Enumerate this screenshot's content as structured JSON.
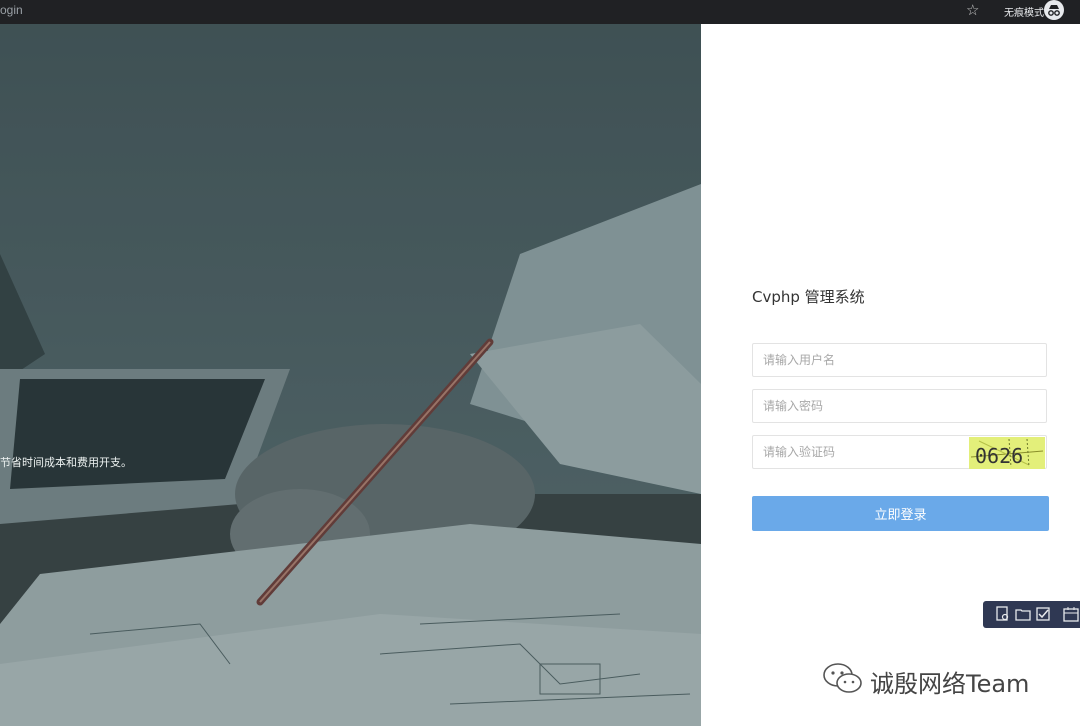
{
  "browser": {
    "url_fragment": "ogin",
    "incognito_label": "无痕模式"
  },
  "hero": {
    "slogan": "节省时间成本和费用开支。"
  },
  "login": {
    "system_title": "Cvphp 管理系统",
    "username_placeholder": "请输入用户名",
    "password_placeholder": "请输入密码",
    "captcha_placeholder": "请输入验证码",
    "captcha_code": "0626",
    "submit_label": "立即登录"
  },
  "watermark": {
    "text": "诚殷网络Team"
  },
  "colors": {
    "button": "#6aa9e9",
    "captcha_bg": "#e3ef7a",
    "toolbar_bg": "#2f3853",
    "topbar_bg": "#202124"
  },
  "icons": [
    "star-icon",
    "incognito-icon",
    "doc-search-icon",
    "folder-icon",
    "checkbox-icon",
    "calendar-icon",
    "wechat-icon"
  ]
}
